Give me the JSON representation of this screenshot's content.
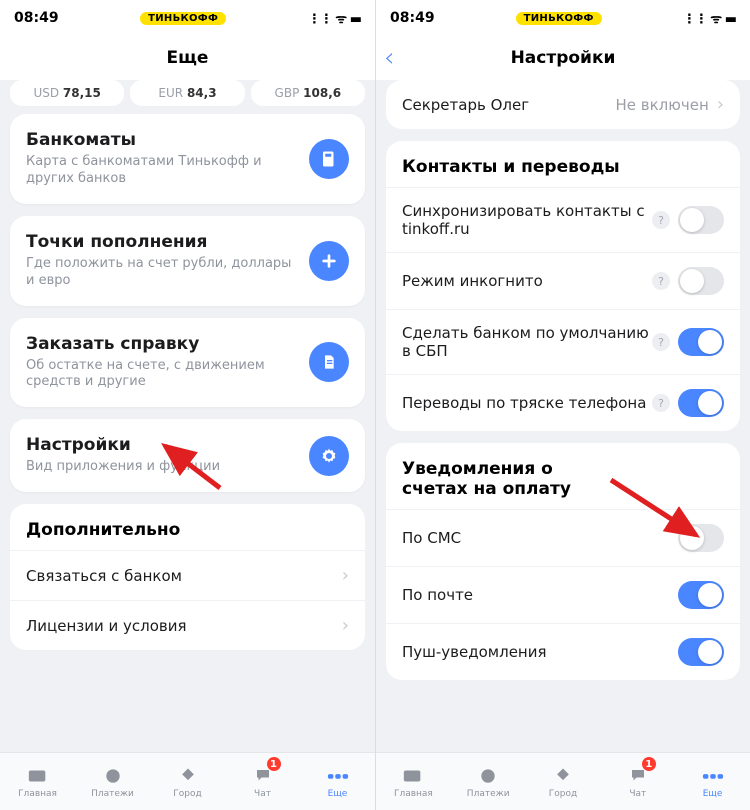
{
  "statusbar": {
    "time": "08:49",
    "brand": "ТИНЬКОФФ"
  },
  "left": {
    "title": "Еще",
    "currencies": [
      {
        "code": "USD",
        "value": "78,15"
      },
      {
        "code": "EUR",
        "value": "84,3"
      },
      {
        "code": "GBP",
        "value": "108,6"
      }
    ],
    "cards": [
      {
        "title": "Банкоматы",
        "sub": "Карта с банкоматами Тинькофф и других банков",
        "icon": "atm"
      },
      {
        "title": "Точки пополнения",
        "sub": "Где положить на счет рубли, доллары и евро",
        "icon": "plus"
      },
      {
        "title": "Заказать справку",
        "sub": "Об остатке на счете, с движением средств и другие",
        "icon": "doc"
      },
      {
        "title": "Настройки",
        "sub": "Вид приложения и функции",
        "icon": "gear"
      }
    ],
    "extra": {
      "title": "Дополнительно",
      "rows": [
        "Связаться с банком",
        "Лицензии и условия"
      ]
    }
  },
  "right": {
    "title": "Настройки",
    "top": {
      "label": "Секретарь Олег",
      "status": "Не включен"
    },
    "contacts": {
      "title": "Контакты и переводы",
      "rows": [
        {
          "label": "Синхронизировать контакты с tinkoff.ru",
          "help": true,
          "on": false
        },
        {
          "label": "Режим инкогнито",
          "help": true,
          "on": false
        },
        {
          "label": "Сделать банком по умолчанию в СБП",
          "help": true,
          "on": true
        },
        {
          "label": "Переводы по тряске телефона",
          "help": true,
          "on": true
        }
      ]
    },
    "notifs": {
      "title": "Уведомления о счетах на оплату",
      "rows": [
        {
          "label": "По СМС",
          "on": false
        },
        {
          "label": "По почте",
          "on": true
        },
        {
          "label": "Пуш-уведомления",
          "on": true
        }
      ]
    }
  },
  "tabs": [
    {
      "label": "Главная",
      "icon": "home"
    },
    {
      "label": "Платежи",
      "icon": "pay"
    },
    {
      "label": "Город",
      "icon": "city"
    },
    {
      "label": "Чат",
      "icon": "chat",
      "badge": "1"
    },
    {
      "label": "Еще",
      "icon": "more",
      "active": true
    }
  ]
}
